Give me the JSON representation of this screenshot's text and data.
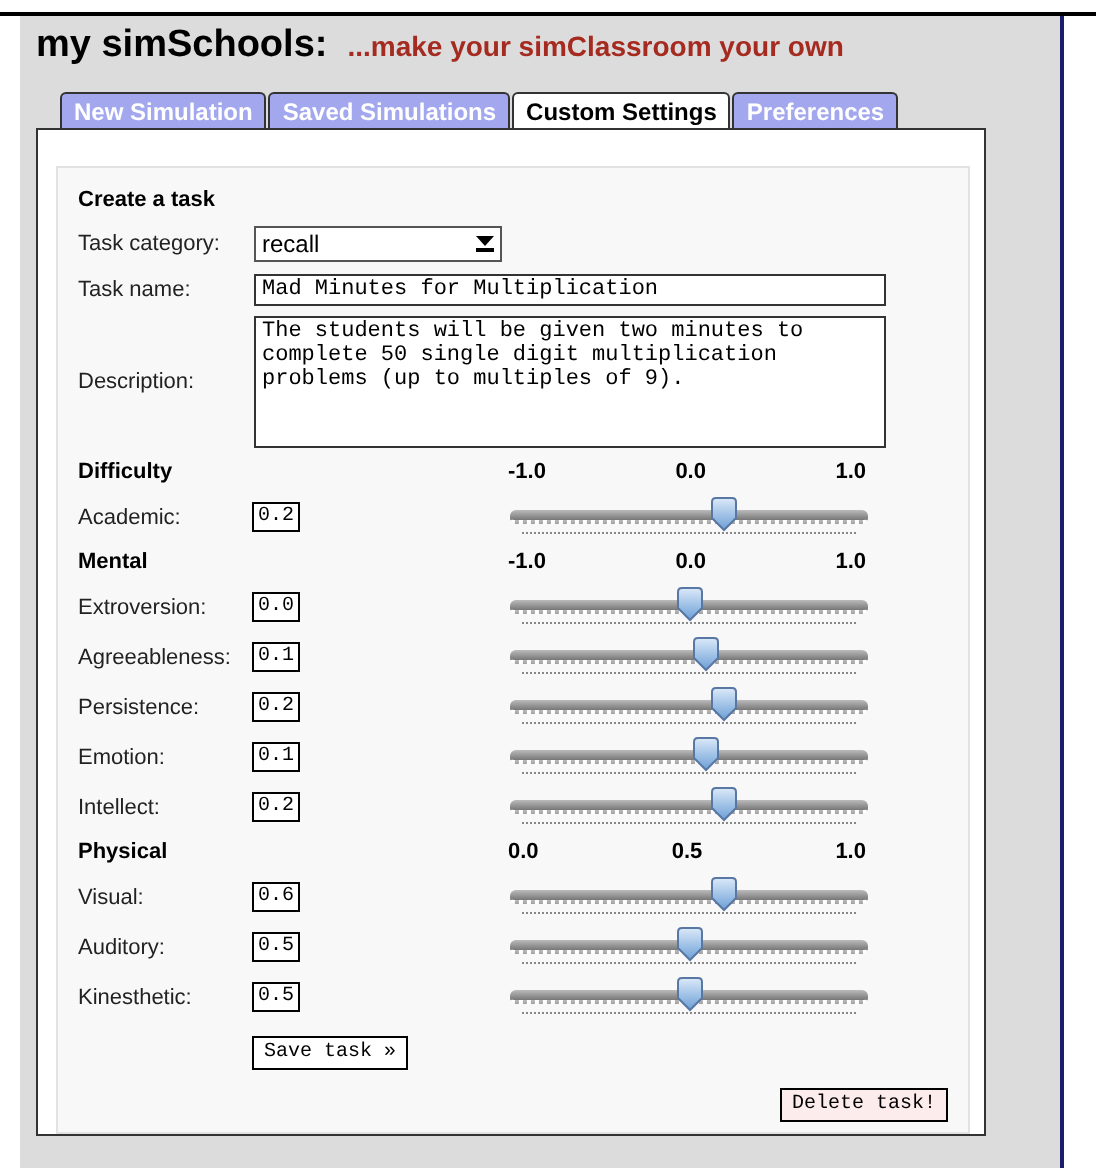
{
  "header": {
    "title": "my simSchools:",
    "tagline": "...make your simClassroom your own"
  },
  "tabs": [
    {
      "label": "New Simulation",
      "selected": false
    },
    {
      "label": "Saved Simulations",
      "selected": false
    },
    {
      "label": "Custom Settings",
      "selected": true
    },
    {
      "label": "Preferences",
      "selected": false
    }
  ],
  "form": {
    "heading": "Create a task",
    "fields": [
      {
        "kind": "select",
        "label": "Task category:",
        "value": "recall"
      },
      {
        "kind": "text",
        "label": "Task name:",
        "value": "Mad Minutes for Multiplication"
      },
      {
        "kind": "textarea",
        "label": "Description:",
        "value": "The students will be given two minutes to complete 50 single digit multiplication problems (up to multiples of 9)."
      }
    ],
    "groups": [
      {
        "title": "Difficulty",
        "ticks": [
          "-1.0",
          "0.0",
          "1.0"
        ],
        "rows": [
          {
            "label": "Academic:",
            "value": "0.2",
            "level": 0.6
          }
        ]
      },
      {
        "title": "Mental",
        "ticks": [
          "-1.0",
          "0.0",
          "1.0"
        ],
        "rows": [
          {
            "label": "Extroversion:",
            "value": "0.0",
            "level": 0.5
          },
          {
            "label": "Agreeableness:",
            "value": "0.1",
            "level": 0.55
          },
          {
            "label": "Persistence:",
            "value": "0.2",
            "level": 0.6
          },
          {
            "label": "Emotion:",
            "value": "0.1",
            "level": 0.55
          },
          {
            "label": "Intellect:",
            "value": "0.2",
            "level": 0.6
          }
        ]
      },
      {
        "title": "Physical",
        "ticks": [
          "0.0",
          "0.5",
          "1.0"
        ],
        "rows": [
          {
            "label": "Visual:",
            "value": "0.6",
            "level": 0.6
          },
          {
            "label": "Auditory:",
            "value": "0.5",
            "level": 0.5
          },
          {
            "label": "Kinesthetic:",
            "value": "0.5",
            "level": 0.5
          }
        ]
      }
    ],
    "save_button": "Save task »",
    "delete_button": "Delete task!"
  }
}
